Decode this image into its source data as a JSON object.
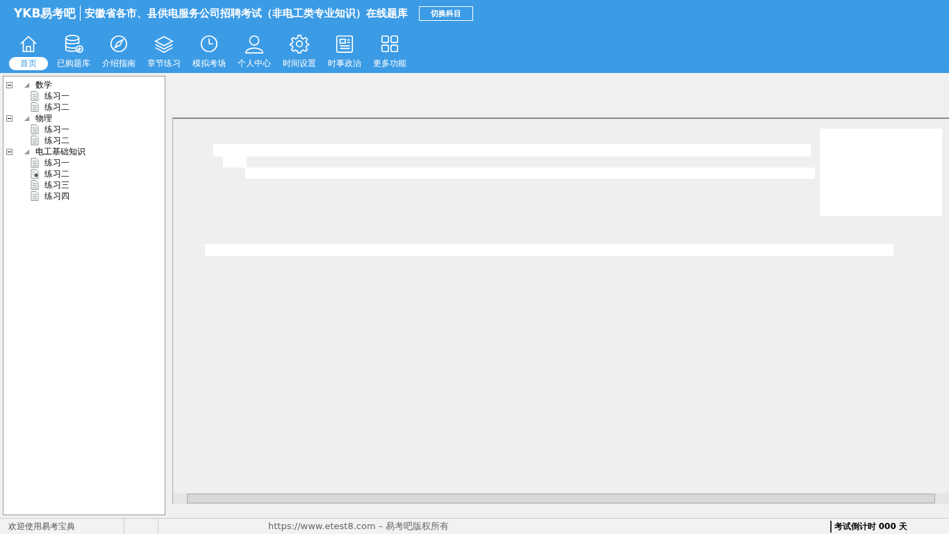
{
  "header": {
    "logo": "YKB易考吧",
    "title": "安徽省各市、县供电服务公司招聘考试（非电工类专业知识）在线题库",
    "switch_button": "切换科目"
  },
  "nav": [
    {
      "kind": "home",
      "label": "首页",
      "selected": true
    },
    {
      "kind": "database",
      "label": "已购题库",
      "selected": false
    },
    {
      "kind": "compass",
      "label": "介绍指南",
      "selected": false
    },
    {
      "kind": "layers",
      "label": "章节练习",
      "selected": false
    },
    {
      "kind": "clock",
      "label": "模拟考场",
      "selected": false
    },
    {
      "kind": "user",
      "label": "个人中心",
      "selected": false
    },
    {
      "kind": "gear",
      "label": "时间设置",
      "selected": false
    },
    {
      "kind": "news",
      "label": "时事政治",
      "selected": false
    },
    {
      "kind": "grid",
      "label": "更多功能",
      "selected": false
    }
  ],
  "tree": [
    {
      "label": "数学",
      "expanded": true,
      "children": [
        {
          "label": "练习一",
          "kind": "doc"
        },
        {
          "label": "练习二",
          "kind": "doc"
        }
      ]
    },
    {
      "label": "物理",
      "expanded": true,
      "children": [
        {
          "label": "练习一",
          "kind": "doc"
        },
        {
          "label": "练习二",
          "kind": "doc"
        }
      ]
    },
    {
      "label": "电工基础知识",
      "expanded": true,
      "children": [
        {
          "label": "练习一",
          "kind": "doc"
        },
        {
          "label": "练习二",
          "kind": "pinned"
        },
        {
          "label": "练习三",
          "kind": "doc"
        },
        {
          "label": "练习四",
          "kind": "doc"
        }
      ]
    }
  ],
  "status_bar": {
    "welcome": "欢迎使用易考宝典",
    "copyright": "https://www.etest8.com – 易考吧版权所有",
    "countdown": "考试倒计时 000 天"
  }
}
